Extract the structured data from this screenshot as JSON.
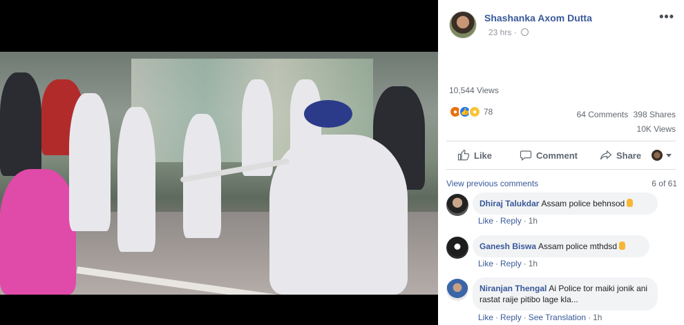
{
  "post": {
    "author": "Shashanka Axom Dutta",
    "time": "23 hrs",
    "menu_label": "•••",
    "views": "10,544 Views",
    "reaction_count": "78",
    "comments_count": "64 Comments",
    "shares_count": "398 Shares",
    "video_views": "10K Views"
  },
  "reactions": [
    "angry-icon",
    "like-icon",
    "sad-icon"
  ],
  "actions": {
    "like": "Like",
    "comment": "Comment",
    "share": "Share"
  },
  "comments_header": {
    "view_previous": "View previous comments",
    "page": "6 of 61"
  },
  "comments": [
    {
      "name": "Dhiraj Talukdar",
      "text": "Assam police behnsod",
      "like": "Like",
      "reply": "Reply",
      "time": "1h"
    },
    {
      "name": "Ganesh Biswa",
      "text": "Assam police mthdsd",
      "like": "Like",
      "reply": "Reply",
      "time": "1h"
    },
    {
      "name": "Niranjan Thengal",
      "text": "Ai Police tor maiki jonik ani rastat raije pitibo lage kla...",
      "like": "Like",
      "reply": "Reply",
      "translate": "See Translation",
      "time": "1h"
    }
  ],
  "colors": {
    "link_blue": "#385898",
    "meta_gray": "#606770",
    "bubble_bg": "#f2f3f5"
  }
}
